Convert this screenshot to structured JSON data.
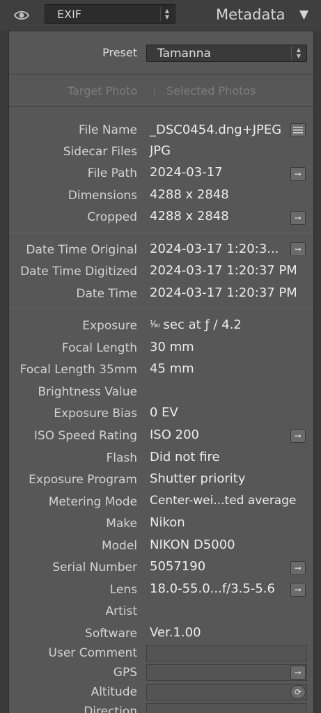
{
  "header": {
    "view_select": "EXIF",
    "panel_title": "Metadata",
    "collapse_glyph": "▼"
  },
  "preset": {
    "label": "Preset",
    "value": "Tamanna"
  },
  "photo_tabs": {
    "target": "Target Photo",
    "selected": "Selected Photos"
  },
  "rows": {
    "file_name": {
      "label": "File Name",
      "value": "_DSC0454.dng+JPEG"
    },
    "sidecar_files": {
      "label": "Sidecar Files",
      "value": "JPG"
    },
    "file_path": {
      "label": "File Path",
      "value": "2024-03-17"
    },
    "dimensions": {
      "label": "Dimensions",
      "value": "4288 x 2848"
    },
    "cropped": {
      "label": "Cropped",
      "value": "4288 x 2848"
    },
    "date_time_original": {
      "label": "Date Time Original",
      "value": "2024-03-17 1:20:3..."
    },
    "date_time_digitized": {
      "label": "Date Time Digitized",
      "value": "2024-03-17 1:20:37 PM"
    },
    "date_time": {
      "label": "Date Time",
      "value": "2024-03-17 1:20:37 PM"
    },
    "exposure": {
      "label": "Exposure",
      "fraction": "¹⁄₃₀",
      "value": " sec at ƒ / 4.2"
    },
    "focal_length": {
      "label": "Focal Length",
      "value": "30 mm"
    },
    "focal_length_35": {
      "label": "Focal Length 35mm",
      "value": "45 mm"
    },
    "brightness_value": {
      "label": "Brightness Value",
      "value": ""
    },
    "exposure_bias": {
      "label": "Exposure Bias",
      "value": "0 EV"
    },
    "iso": {
      "label": "ISO Speed Rating",
      "value": "ISO 200"
    },
    "flash": {
      "label": "Flash",
      "value": "Did not fire"
    },
    "exposure_program": {
      "label": "Exposure Program",
      "value": "Shutter priority"
    },
    "metering_mode": {
      "label": "Metering Mode",
      "value": "Center-wei...ted average"
    },
    "make": {
      "label": "Make",
      "value": "Nikon"
    },
    "model": {
      "label": "Model",
      "value": "NIKON D5000"
    },
    "serial_number": {
      "label": "Serial Number",
      "value": "5057190"
    },
    "lens": {
      "label": "Lens",
      "value": "18.0-55.0...f/3.5-5.6"
    },
    "artist": {
      "label": "Artist",
      "value": ""
    },
    "software": {
      "label": "Software",
      "value": "Ver.1.00"
    },
    "user_comment": {
      "label": "User Comment",
      "value": ""
    },
    "gps": {
      "label": "GPS",
      "value": ""
    },
    "altitude": {
      "label": "Altitude",
      "value": ""
    },
    "direction": {
      "label": "Direction",
      "value": ""
    }
  },
  "icons": {
    "eye": "eye-icon",
    "list": "list-icon",
    "arrow": "arrow-right-icon",
    "sync": "sync-icon",
    "arrow_glyph": "➙",
    "sync_glyph": "⟳"
  }
}
